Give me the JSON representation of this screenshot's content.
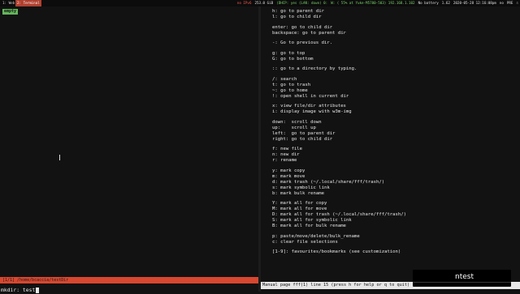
{
  "topbar": {
    "workspaces": [
      "1: Web",
      "2: Terminal"
    ],
    "active_workspace": 1,
    "status_items": [
      {
        "text": "no IPv6",
        "color": "#ff5a4f"
      },
      {
        "text": "253.0 GiB",
        "color": "#e0e0e0"
      },
      {
        "text": "(DHCP: yes (LAN: down) 0:",
        "color": "#7cd36b"
      },
      {
        "text": "W: ( 55% at Yuke-M5700-503) 192.168.1.102",
        "color": "#7cd36b"
      },
      {
        "text": "No battery",
        "color": "#e0e0e0"
      },
      {
        "text": "1.62",
        "color": "#e0e0e0"
      },
      {
        "text": "2020-05-28 12:16:08pm",
        "color": "#e0e0e0"
      },
      {
        "text": "no",
        "color": "#e0e0e0"
      },
      {
        "text": "PRE",
        "color": "#e0e0e0"
      },
      {
        "text": "☃",
        "color": "#e0e0e0"
      }
    ]
  },
  "left_pane": {
    "empty_label": "empty",
    "path_bar": "[1/1] /home/bcaccia/testDir",
    "cmdline": "mkdir: test"
  },
  "help_text": [
    "h: go to parent dir",
    "l: go to child dir",
    "",
    "enter: go to child dir",
    "backspace: go to parent dir",
    "",
    "-: Go to previous dir.",
    "",
    "g: go to top",
    "G: go to bottom",
    "",
    ":: go to a directory by typing.",
    "",
    "/: search",
    "t: go to trash",
    "~: go to home",
    "!: open shell in current dir",
    "",
    "x: view file/dir attributes",
    "i: display image with w3m-img",
    "",
    "down:  scroll down",
    "up:    scroll up",
    "left:  go to parent dir",
    "right: go to child dir",
    "",
    "f: new file",
    "n: new dir",
    "r: rename",
    "",
    "y: mark copy",
    "m: mark move",
    "d: mark trash (~/.local/share/fff/trash/)",
    "s: mark symbolic link",
    "b: mark bulk rename",
    "",
    "Y: mark all for copy",
    "M: mark all for move",
    "D: mark all for trash (~/.local/share/fff/trash/)",
    "S: mark all for symbolic link",
    "B: mark all for bulk rename",
    "",
    "p: paste/move/delete/bulk_rename",
    "c: clear file selections",
    "",
    "[1-9]: favourites/bookmarks (see customization)"
  ],
  "manual_bar": "Manual page fff(1) line 15 (press h for help or q to quit)",
  "overlay_text": "ntest"
}
